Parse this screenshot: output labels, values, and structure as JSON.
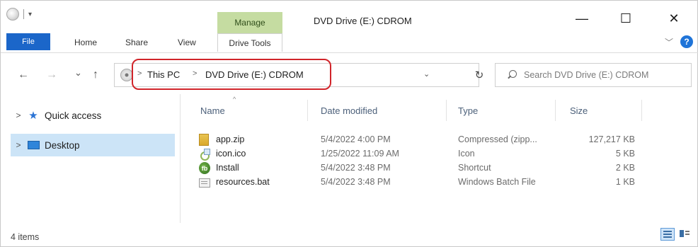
{
  "window": {
    "title": "DVD Drive (E:) CDROM",
    "minimize_glyph": "—",
    "maximize_glyph": "☐",
    "close_glyph": "✕"
  },
  "quick_access_toolbar": {
    "dropdown_glyph": "▾"
  },
  "ribbon": {
    "context_group_label": "Manage",
    "tabs": [
      "File",
      "Home",
      "Share",
      "View",
      "Drive Tools"
    ],
    "collapse_glyph": "﹀",
    "help_glyph": "?"
  },
  "navigation": {
    "back_glyph": "←",
    "forward_glyph": "→",
    "recent_glyph": "⌄",
    "up_glyph": "↑",
    "breadcrumb": [
      "This PC",
      "DVD Drive (E:) CDROM"
    ],
    "breadcrumb_separator": ">",
    "address_dropdown_glyph": "⌄",
    "refresh_glyph": "↻",
    "search_placeholder": "Search DVD Drive (E:) CDROM",
    "highlight_color": "#d1242a"
  },
  "sidebar": {
    "items": [
      {
        "label": "Quick access",
        "icon": "star-icon",
        "selected": false
      },
      {
        "label": "Desktop",
        "icon": "desktop-folder-icon",
        "selected": true
      }
    ]
  },
  "file_list": {
    "columns": [
      "Name",
      "Date modified",
      "Type",
      "Size"
    ],
    "sort_indicator": "^",
    "rows": [
      {
        "name": "app.zip",
        "date": "5/4/2022 4:00 PM",
        "type": "Compressed (zipp...",
        "size": "127,217 KB",
        "icon": "zip-folder-icon"
      },
      {
        "name": "icon.ico",
        "date": "1/25/2022 11:09 AM",
        "type": "Icon",
        "size": "5 KB",
        "icon": "icon-file-icon"
      },
      {
        "name": "Install",
        "date": "5/4/2022 3:48 PM",
        "type": "Shortcut",
        "size": "2 KB",
        "icon": "shortcut-icon"
      },
      {
        "name": "resources.bat",
        "date": "5/4/2022 3:48 PM",
        "type": "Windows Batch File",
        "size": "1 KB",
        "icon": "batch-file-icon"
      }
    ]
  },
  "status_bar": {
    "item_count": "4 items"
  },
  "colors": {
    "file_tab": "#1b66c9",
    "manage_tab": "#c5dca1",
    "selection": "#cce4f7"
  }
}
